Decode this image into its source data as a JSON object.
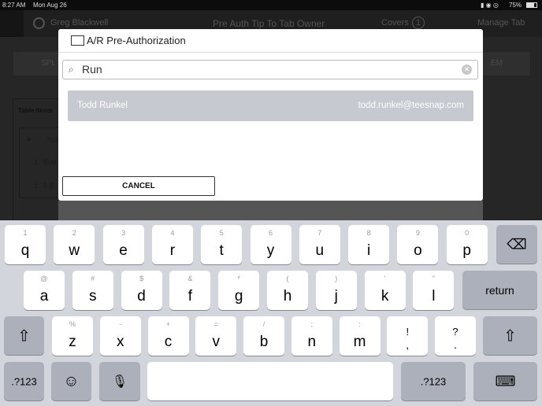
{
  "status": {
    "time": "8:27 AM",
    "date": "Mon Aug 26",
    "battery": "75%"
  },
  "appbar": {
    "user": "Greg Blackwell",
    "title": "Pre Auth Tip To Tab Owner",
    "covers_label": "Covers",
    "covers_count": "1",
    "manage": "Manage Tab"
  },
  "background": {
    "table_items": "Table Items",
    "split": "SPL",
    "item_btn": "EM",
    "rows": [
      {
        "qty": "",
        "name": "Tod"
      },
      {
        "qty": "1",
        "name": "Bud"
      },
      {
        "qty": "1",
        "name": "6 B"
      }
    ]
  },
  "modal": {
    "title": "A/R Pre-Authorization",
    "search_value": "Run",
    "result": {
      "name": "Todd Runkel",
      "email": "todd.runkel@teesnap.com"
    },
    "cancel": "CANCEL"
  },
  "keyboard": {
    "row1": [
      [
        "q",
        "1"
      ],
      [
        "w",
        "2"
      ],
      [
        "e",
        "3"
      ],
      [
        "r",
        "4"
      ],
      [
        "t",
        "5"
      ],
      [
        "y",
        "6"
      ],
      [
        "u",
        "7"
      ],
      [
        "i",
        "8"
      ],
      [
        "o",
        "9"
      ],
      [
        "p",
        "0"
      ]
    ],
    "row2": [
      [
        "a",
        "@"
      ],
      [
        "s",
        "#"
      ],
      [
        "d",
        "$"
      ],
      [
        "f",
        "&"
      ],
      [
        "g",
        "*"
      ],
      [
        "h",
        "("
      ],
      [
        "j",
        ")"
      ],
      [
        "k",
        "'"
      ],
      [
        "l",
        "\""
      ]
    ],
    "row3": [
      [
        "z",
        "%"
      ],
      [
        "x",
        "-"
      ],
      [
        "c",
        "+"
      ],
      [
        "v",
        "="
      ],
      [
        "b",
        "/"
      ],
      [
        "n",
        ";"
      ],
      [
        "m",
        ":"
      ],
      [
        ",",
        "!"
      ],
      [
        ".",
        "?"
      ]
    ],
    "return": "return",
    "numbers": ".?123"
  }
}
